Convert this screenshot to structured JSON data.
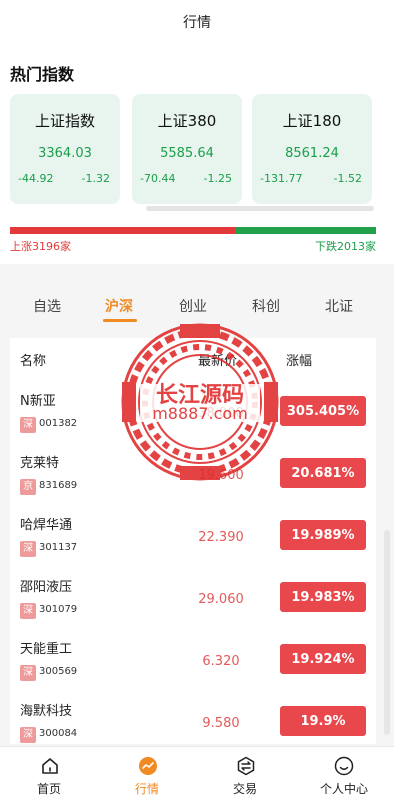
{
  "header": {
    "title": "行情"
  },
  "hot": {
    "title": "热门指数",
    "cards": [
      {
        "name": "上证指数",
        "price": "3364.03",
        "change": "-44.92",
        "pct": "-1.32"
      },
      {
        "name": "上证380",
        "price": "5585.64",
        "change": "-70.44",
        "pct": "-1.25"
      },
      {
        "name": "上证180",
        "price": "8561.24",
        "change": "-131.77",
        "pct": "-1.52"
      }
    ],
    "up_count": 3196,
    "down_count": 2013,
    "up_text": "上涨3196家",
    "down_text": "下跌2013家",
    "colors": {
      "up": "#e23a3a",
      "down": "#22a04b",
      "accent": "#f08a22"
    }
  },
  "tabs": [
    {
      "label": "自选",
      "active": false
    },
    {
      "label": "沪深",
      "active": true
    },
    {
      "label": "创业",
      "active": false
    },
    {
      "label": "科创",
      "active": false
    },
    {
      "label": "北证",
      "active": false
    }
  ],
  "list": {
    "headers": {
      "name": "名称",
      "last": "最新价",
      "pct": "涨幅"
    },
    "rows": [
      {
        "name": "N新亚",
        "market": "深",
        "code": "001382",
        "last": "38.000",
        "pct": "305.405%"
      },
      {
        "name": "克莱特",
        "market": "京",
        "code": "831689",
        "last": "19.600",
        "pct": "20.681%"
      },
      {
        "name": "哈焊华通",
        "market": "深",
        "code": "301137",
        "last": "22.390",
        "pct": "19.989%"
      },
      {
        "name": "邵阳液压",
        "market": "深",
        "code": "301079",
        "last": "29.060",
        "pct": "19.983%"
      },
      {
        "name": "天能重工",
        "market": "深",
        "code": "300569",
        "last": "6.320",
        "pct": "19.924%"
      },
      {
        "name": "海默科技",
        "market": "深",
        "code": "300084",
        "last": "9.580",
        "pct": "19.9%"
      }
    ]
  },
  "watermark": {
    "line1": "长江源码",
    "line2": "m8887.com"
  },
  "nav": [
    {
      "label": "首页",
      "icon": "home-icon",
      "active": false
    },
    {
      "label": "行情",
      "icon": "market-icon",
      "active": true
    },
    {
      "label": "交易",
      "icon": "exchange-icon",
      "active": false
    },
    {
      "label": "个人中心",
      "icon": "user-icon",
      "active": false
    }
  ]
}
